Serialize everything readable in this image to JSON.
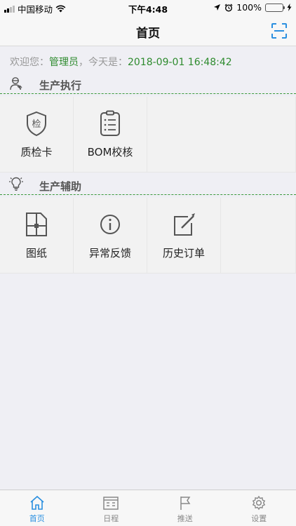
{
  "status_bar": {
    "carrier": "中国移动",
    "time": "下午4:48",
    "battery_percent": "100%",
    "battery_level": 1.0
  },
  "navbar": {
    "title": "首页",
    "scan_icon": "scan-icon"
  },
  "welcome": {
    "prefix": "欢迎您：",
    "user": "管理员",
    "middle": "，今天是：",
    "datetime": "2018-09-01 16:48:42"
  },
  "sections": [
    {
      "title": "生产执行",
      "icon": "worker-icon",
      "tiles": [
        {
          "label": "质检卡",
          "icon": "inspection-shield-icon"
        },
        {
          "label": "BOM校核",
          "icon": "checklist-clipboard-icon"
        }
      ]
    },
    {
      "title": "生产辅助",
      "icon": "lightbulb-icon",
      "tiles": [
        {
          "label": "图纸",
          "icon": "drawing-blueprint-icon"
        },
        {
          "label": "异常反馈",
          "icon": "info-circle-icon"
        },
        {
          "label": "历史订单",
          "icon": "edit-note-icon"
        }
      ]
    }
  ],
  "tabbar": {
    "active_index": 0,
    "accent_color": "#2a8fe0",
    "tabs": [
      {
        "label": "首页",
        "icon": "home-icon"
      },
      {
        "label": "日程",
        "icon": "calendar-icon"
      },
      {
        "label": "推送",
        "icon": "flag-icon"
      },
      {
        "label": "设置",
        "icon": "gear-icon"
      }
    ]
  }
}
